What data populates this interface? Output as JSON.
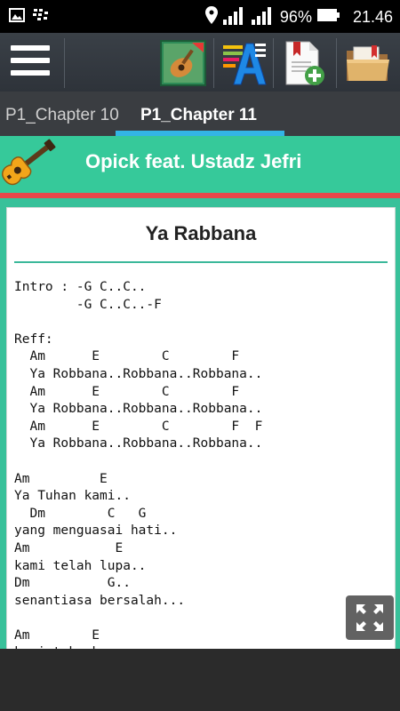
{
  "status": {
    "battery": "96%",
    "time": "21.46",
    "icons": [
      "image-icon",
      "bbm-icon",
      "location-icon",
      "signal-icon",
      "signal-icon",
      "battery-icon"
    ]
  },
  "toolbar": {
    "icons": [
      "hamburger-menu-icon",
      "guitar-app-icon",
      "font-size-icon",
      "add-bookmark-icon",
      "folder-icon"
    ]
  },
  "tabs": {
    "prev": "P1_Chapter 10",
    "active": "P1_Chapter 11"
  },
  "banner": {
    "title": "Opick feat. Ustadz Jefri"
  },
  "song": {
    "title": "Ya Rabbana",
    "lyrics": "Intro : -G C..C..\n        -G C..C..-F\n\nReff:\n  Am      E        C        F\n  Ya Robbana..Robbana..Robbana..\n  Am      E        C        F\n  Ya Robbana..Robbana..Robbana..\n  Am      E        C        F  F\n  Ya Robbana..Robbana..Robbana..\n\nAm         E\nYa Tuhan kami..\n  Dm        C   G\nyang menguasai hati..\nAm           E\nkami telah lupa..\nDm          G..\nsenantiasa bersalah...\n\nAm        E\nkami tak akan"
  },
  "colors": {
    "banner": "#36c99a",
    "accent_line": "#e8474a",
    "tab_indicator": "#33b5e5"
  }
}
